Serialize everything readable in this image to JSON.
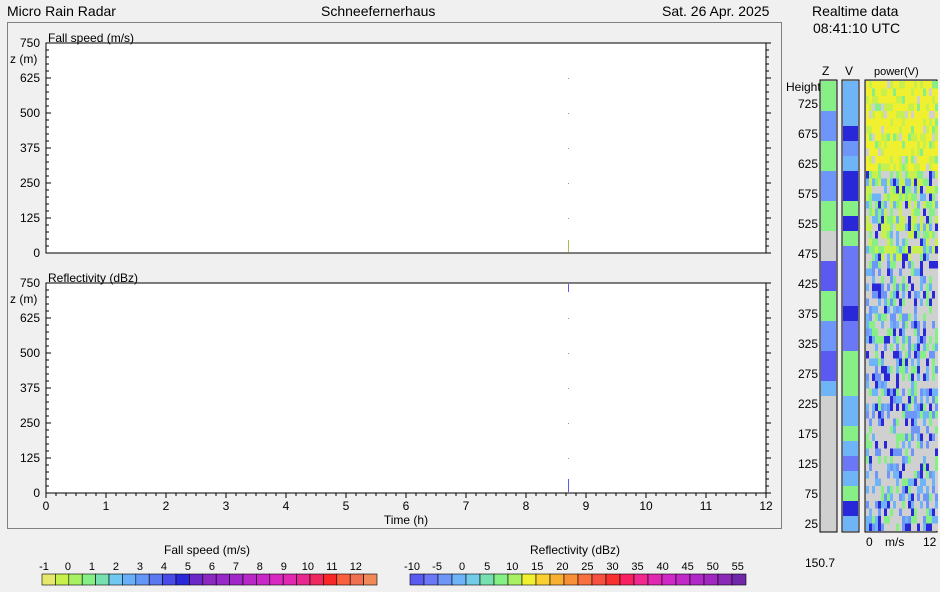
{
  "header": {
    "app_title": "Micro Rain Radar",
    "station": "Schneefernerhaus",
    "date": "Sat.  26 Apr. 2025",
    "realtime_label": "Realtime data",
    "time": "08:41:10  UTC"
  },
  "plots": {
    "fall_speed": {
      "title": "Fall speed (m/s)",
      "zlabel": "z (m)",
      "y_ticks": [
        "750",
        "625",
        "500",
        "375",
        "250",
        "125",
        "0"
      ]
    },
    "reflectivity": {
      "title": "Reflectivity (dBz)",
      "zlabel": "z (m)",
      "y_ticks": [
        "750",
        "625",
        "500",
        "375",
        "250",
        "125",
        "0"
      ],
      "x_ticks": [
        "0",
        "1",
        "2",
        "3",
        "4",
        "5",
        "6",
        "7",
        "8",
        "9",
        "10",
        "11",
        "12"
      ],
      "xlabel": "Time (h)"
    }
  },
  "realtime": {
    "col_z": "Z",
    "col_v": "V",
    "col_power": "power(V)",
    "height_label": "Height",
    "heights": [
      "725",
      "675",
      "625",
      "575",
      "525",
      "475",
      "425",
      "375",
      "325",
      "275",
      "225",
      "175",
      "125",
      "75",
      "25"
    ],
    "power_axis": [
      "0",
      "m/s",
      "12"
    ],
    "footer_value": "150.7"
  },
  "legends": {
    "fall_speed": {
      "title": "Fall speed (m/s)",
      "labels": [
        "-1",
        "0",
        "1",
        "2",
        "3",
        "4",
        "5",
        "6",
        "7",
        "8",
        "9",
        "10",
        "11",
        "12"
      ],
      "colors": [
        "#e6e86e",
        "#c8f04c",
        "#a8f064",
        "#86f086",
        "#78e0b0",
        "#70c8f0",
        "#6ab0f8",
        "#6496f8",
        "#5a78f0",
        "#4a4ae8",
        "#2828d8",
        "#6a28c8",
        "#8a28c0",
        "#9828c8",
        "#a028c8",
        "#b828c8",
        "#c828c8",
        "#d828c0",
        "#e028b0",
        "#e82890",
        "#f02860",
        "#f82828",
        "#f86040",
        "#f07050",
        "#f08858"
      ]
    },
    "reflectivity": {
      "title": "Reflectivity (dBz)",
      "labels": [
        "-10",
        "-5",
        "0",
        "5",
        "10",
        "15",
        "20",
        "25",
        "30",
        "35",
        "40",
        "45",
        "50",
        "55"
      ],
      "colors": [
        "#5a5af0",
        "#6a78f8",
        "#6e96f8",
        "#70b4f8",
        "#72cce8",
        "#78e0b0",
        "#86f086",
        "#a8f064",
        "#f0f030",
        "#f8d030",
        "#f8b030",
        "#f89038",
        "#f87040",
        "#f85040",
        "#f83030",
        "#f82060",
        "#f02890",
        "#e028b0",
        "#d028c8",
        "#c028c8",
        "#b028c8",
        "#a028c0",
        "#8a28b8",
        "#7028a8"
      ]
    }
  }
}
